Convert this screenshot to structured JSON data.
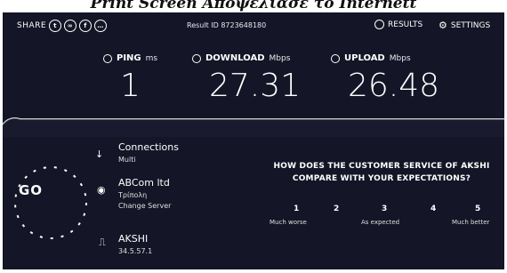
{
  "caption": "Print Screen Αποψελίασε το Internett",
  "header": {
    "share_label": "SHARE",
    "result_id": "Result ID 8723648180",
    "results_label": "RESULTS",
    "settings_label": "SETTINGS"
  },
  "metrics": {
    "ping": {
      "label": "PING",
      "unit": "ms",
      "value": "1"
    },
    "download": {
      "label": "DOWNLOAD",
      "unit": "Mbps",
      "value": "27.31"
    },
    "upload": {
      "label": "UPLOAD",
      "unit": "Mbps",
      "value": "26.48"
    }
  },
  "go_label": "GO",
  "connections": {
    "title": "Connections",
    "sub": "Multi"
  },
  "provider": {
    "title": "ABCom ltd",
    "sub1": "Τρίπολη",
    "sub2": "Change Server"
  },
  "host": {
    "title": "AKSHI",
    "sub": "34.5.57.1"
  },
  "survey": {
    "question": "HOW DOES THE CUSTOMER SERVICE OF AKSHI COMPARE WITH YOUR EXPECTATIONS?",
    "scale": [
      "1",
      "2",
      "3",
      "4",
      "5"
    ],
    "low_label": "Much worse",
    "mid_label": "As expected",
    "high_label": "Much better"
  }
}
